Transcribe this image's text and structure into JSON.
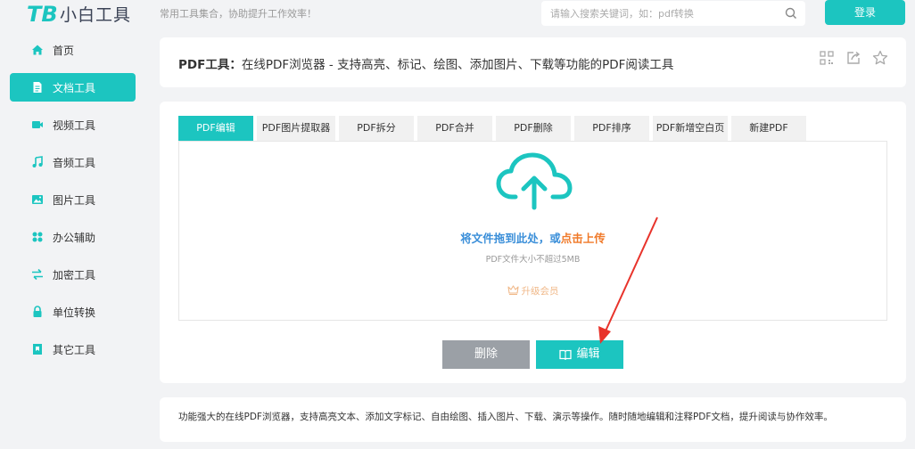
{
  "header": {
    "logo_text": "小白工具",
    "slogan": "常用工具集合，协助提升工作效率！",
    "search_placeholder": "请输入搜索关键词，如：pdf转换",
    "login_label": "登录"
  },
  "sidebar": {
    "items": [
      {
        "label": "首页",
        "icon": "home-icon"
      },
      {
        "label": "文档工具",
        "icon": "document-icon",
        "active": true
      },
      {
        "label": "视频工具",
        "icon": "video-icon"
      },
      {
        "label": "音频工具",
        "icon": "music-icon"
      },
      {
        "label": "图片工具",
        "icon": "image-icon"
      },
      {
        "label": "办公辅助",
        "icon": "grid-icon"
      },
      {
        "label": "加密工具",
        "icon": "exchange-icon"
      },
      {
        "label": "单位转换",
        "icon": "lock-icon"
      },
      {
        "label": "其它工具",
        "icon": "bookmark-icon"
      }
    ]
  },
  "title_card": {
    "tool_name": "PDF工具：",
    "description": "在线PDF浏览器 - 支持高亮、标记、绘图、添加图片、下载等功能的PDF阅读工具",
    "actions": [
      "qrcode-icon",
      "share-icon",
      "star-icon"
    ]
  },
  "tabs": [
    {
      "label": "PDF编辑",
      "active": true
    },
    {
      "label": "PDF图片提取器"
    },
    {
      "label": "PDF拆分"
    },
    {
      "label": "PDF合并"
    },
    {
      "label": "PDF删除"
    },
    {
      "label": "PDF排序"
    },
    {
      "label": "PDF新增空白页"
    },
    {
      "label": "新建PDF"
    }
  ],
  "upload": {
    "drag_text": "将文件拖到此处，或",
    "click_text": "点击上传",
    "hint": "PDF文件大小不超过5MB",
    "upgrade_label": "升级会员"
  },
  "buttons": {
    "delete_label": "删除",
    "edit_label": "编辑"
  },
  "footer_description": "功能强大的在线PDF浏览器，支持高亮文本、添加文字标记、自由绘图、插入图片、下载、演示等操作。随时随地编辑和注释PDF文档，提升阅读与协作效率。",
  "colors": {
    "accent": "#1cc5c0",
    "link_blue": "#3b8fd9",
    "link_orange": "#f07a2a",
    "delete_gray": "#9ba0a6",
    "arrow_red": "#e8332b"
  }
}
